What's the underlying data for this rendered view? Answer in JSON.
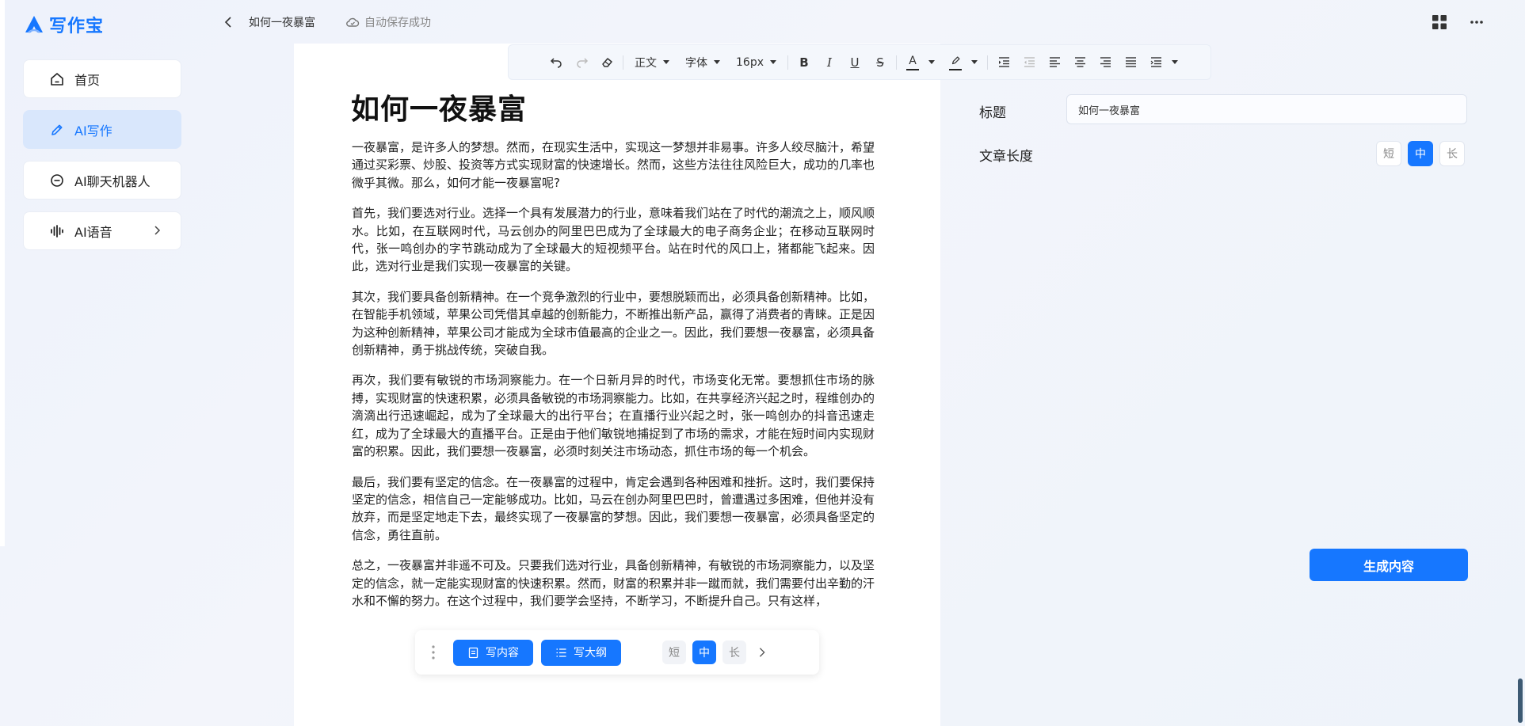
{
  "app": {
    "logo_text": "写作宝"
  },
  "sidebar": {
    "items": [
      {
        "label": "首页",
        "icon": "home-icon"
      },
      {
        "label": "AI写作",
        "icon": "pen-icon"
      },
      {
        "label": "AI聊天机器人",
        "icon": "chat-icon"
      },
      {
        "label": "AI语音",
        "icon": "voice-icon"
      }
    ]
  },
  "header": {
    "doc_title": "如何一夜暴富",
    "autosave_text": "自动保存成功"
  },
  "toolbar": {
    "paragraph_style": "正文",
    "font_family": "字体",
    "font_size": "16px",
    "bold": "B",
    "italic": "I",
    "underline": "U",
    "strike": "S",
    "font_color_letter": "A"
  },
  "document": {
    "title": "如何一夜暴富",
    "paragraphs": [
      "一夜暴富，是许多人的梦想。然而，在现实生活中，实现这一梦想并非易事。许多人绞尽脑汁，希望通过买彩票、炒股、投资等方式实现财富的快速增长。然而，这些方法往往风险巨大，成功的几率也微乎其微。那么，如何才能一夜暴富呢?",
      "首先，我们要选对行业。选择一个具有发展潜力的行业，意味着我们站在了时代的潮流之上，顺风顺水。比如，在互联网时代，马云创办的阿里巴巴成为了全球最大的电子商务企业；在移动互联网时代，张一鸣创办的字节跳动成为了全球最大的短视频平台。站在时代的风口上，猪都能飞起来。因此，选对行业是我们实现一夜暴富的关键。",
      "其次，我们要具备创新精神。在一个竞争激烈的行业中，要想脱颖而出，必须具备创新精神。比如，在智能手机领域，苹果公司凭借其卓越的创新能力，不断推出新产品，赢得了消费者的青睐。正是因为这种创新精神，苹果公司才能成为全球市值最高的企业之一。因此，我们要想一夜暴富，必须具备创新精神，勇于挑战传统，突破自我。",
      "再次，我们要有敏锐的市场洞察能力。在一个日新月异的时代，市场变化无常。要想抓住市场的脉搏，实现财富的快速积累，必须具备敏锐的市场洞察能力。比如，在共享经济兴起之时，程维创办的滴滴出行迅速崛起，成为了全球最大的出行平台；在直播行业兴起之时，张一鸣创办的抖音迅速走红，成为了全球最大的直播平台。正是由于他们敏锐地捕捉到了市场的需求，才能在短时间内实现财富的积累。因此，我们要想一夜暴富，必须时刻关注市场动态，抓住市场的每一个机会。",
      "最后，我们要有坚定的信念。在一夜暴富的过程中，肯定会遇到各种困难和挫折。这时，我们要保持坚定的信念，相信自己一定能够成功。比如，马云在创办阿里巴巴时，曾遭遇过多困难，但他并没有放弃，而是坚定地走下去，最终实现了一夜暴富的梦想。因此，我们要想一夜暴富，必须具备坚定的信念，勇往直前。",
      "总之，一夜暴富并非遥不可及。只要我们选对行业，具备创新精神，有敏锐的市场洞察能力，以及坚定的信念，就一定能实现财富的快速积累。然而，财富的积累并非一蹴而就，我们需要付出辛勤的汗水和不懈的努力。在这个过程中，我们要学会坚持，不断学习，不断提升自己。只有这样，"
    ]
  },
  "settings": {
    "title_label": "标题",
    "title_value": "如何一夜暴富",
    "length_label": "文章长度",
    "length_options": [
      "短",
      "中",
      "长"
    ],
    "length_selected": "中",
    "generate_label": "生成内容"
  },
  "floatbar": {
    "write_content": "写内容",
    "write_outline": "写大纲",
    "length_options": [
      "短",
      "中",
      "长"
    ],
    "length_selected": "中"
  },
  "colors": {
    "accent": "#1677ff",
    "active_nav_bg": "#d9e7fc"
  }
}
